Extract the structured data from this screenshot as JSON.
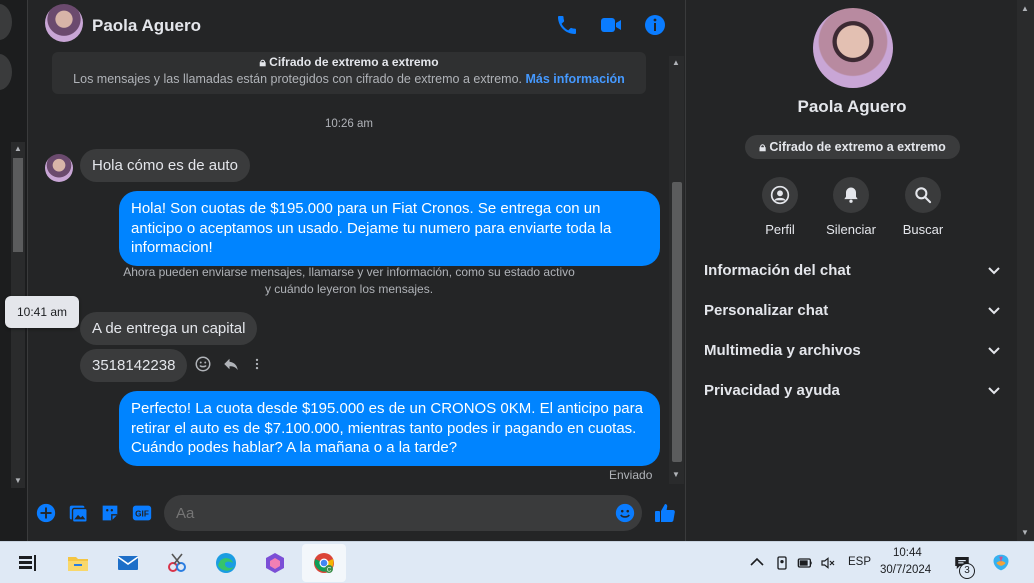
{
  "contact": {
    "name": "Paola Aguero"
  },
  "encryption": {
    "title": "Cifrado de extremo a extremo",
    "text": "Los mensajes y las llamadas están protegidos con cifrado de extremo a extremo.",
    "link": "Más información"
  },
  "messages": {
    "time_label": "10:26 am",
    "m1": "Hola cómo es de auto",
    "m2": "Hola! Son cuotas de $195.000 para un Fiat Cronos. Se entrega con un anticipo o aceptamos un usado. Dejame tu numero para enviarte toda la informacion!",
    "system_note": "Ahora pueden enviarse mensajes, llamarse y ver información, como su estado activo y cuándo leyeron los mensajes.",
    "m3": "A de entrega un capital",
    "m4": "3518142238",
    "tooltip": "10:41 am",
    "m5": "Perfecto! La cuota desde $195.000 es de un CRONOS 0KM. El anticipo para retirar el auto es de $7.100.000, mientras tanto podes ir pagando en cuotas. Cuándo podes hablar? A la mañana o a la tarde?",
    "status": "Enviado"
  },
  "composer": {
    "placeholder": "Aa"
  },
  "info_panel": {
    "name": "Paola Aguero",
    "badge": "Cifrado de extremo a extremo",
    "actions": {
      "profile": "Perfil",
      "mute": "Silenciar",
      "search": "Buscar"
    },
    "sections": {
      "chat_info": "Información del chat",
      "customize": "Personalizar chat",
      "media": "Multimedia y archivos",
      "privacy": "Privacidad y ayuda"
    }
  },
  "taskbar": {
    "language": "ESP",
    "time": "10:44",
    "date": "30/7/2024",
    "notification_count": "3"
  },
  "colors": {
    "accent": "#0084ff",
    "background": "#242526",
    "bubble_in": "#3a3b3c"
  }
}
